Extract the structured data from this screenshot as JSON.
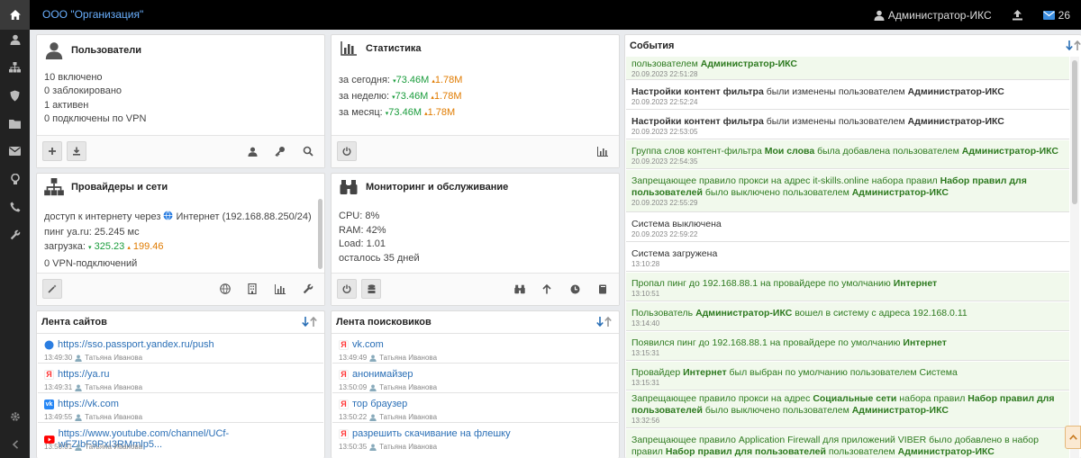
{
  "topbar": {
    "org_title": "ООО \"Организация\"",
    "user": "Администратор-ИКС",
    "messages_count": "26"
  },
  "sidebar": {
    "items": [
      "user-icon",
      "network-icon",
      "shield-icon",
      "folder-icon",
      "mail-icon",
      "bulb-icon",
      "phone-icon",
      "wrench-icon"
    ],
    "bottom": [
      "settings-icon",
      "collapse-icon"
    ]
  },
  "users": {
    "title": "Пользователи",
    "lines": [
      "10 включено",
      "0 заблокировано",
      "1 активен",
      "0 подключены по VPN"
    ]
  },
  "stats": {
    "title": "Статистика",
    "rows": [
      {
        "label": "за сегодня:",
        "down": "73.46M",
        "up": "1.78M"
      },
      {
        "label": "за неделю:",
        "down": "73.46M",
        "up": "1.78M"
      },
      {
        "label": "за месяц:",
        "down": "73.46M",
        "up": "1.78M"
      }
    ]
  },
  "providers": {
    "title": "Провайдеры и сети",
    "access_prefix": "доступ к интернету через",
    "access_value": "Интернет (192.168.88.250/24)",
    "ping": "пинг ya.ru: 25.245 мс",
    "load_label": "загрузка:",
    "load_down": "325.23",
    "load_up": "199.46",
    "vpn": "0 VPN-подключений"
  },
  "monitoring": {
    "title": "Мониторинг и обслуживание",
    "lines": [
      "CPU: 8%",
      "RAM: 42%",
      "Load: 1.01",
      "осталось 35 дней"
    ]
  },
  "sites": {
    "title": "Лента сайтов",
    "items": [
      {
        "url": "https://sso.passport.yandex.ru/push",
        "time": "13:49:30",
        "user": "Татьяна Иванова",
        "icon": "globe",
        "color": "#2a7de1"
      },
      {
        "url": "https://ya.ru",
        "time": "13:49:31",
        "user": "Татьяна Иванова",
        "icon": "ya",
        "color": "#ff3333"
      },
      {
        "url": "https://vk.com",
        "time": "13:49:55",
        "user": "Татьяна Иванова",
        "icon": "vk",
        "color": "#2787f5"
      },
      {
        "url": "https://www.youtube.com/channel/UCf-wFZIbF9PxI3RMmlp5...",
        "time": "13:50:01",
        "user": "Татьяна Иванова",
        "icon": "yt",
        "color": "#ff0000"
      }
    ]
  },
  "searches": {
    "title": "Лента поисковиков",
    "items": [
      {
        "query": "vk.com",
        "time": "13:49:49",
        "user": "Татьяна Иванова"
      },
      {
        "query": "анонимайзер",
        "time": "13:50:09",
        "user": "Татьяна Иванова"
      },
      {
        "query": "тор браузер",
        "time": "13:50:22",
        "user": "Татьяна Иванова"
      },
      {
        "query": "разрешить скачивание на флешку",
        "time": "13:50:35",
        "user": "Татьяна Иванова"
      }
    ]
  },
  "events": {
    "title": "События",
    "items": [
      {
        "style": "green",
        "parts": [
          [
            "пользователем ",
            false
          ],
          [
            "Администратор-ИКС",
            true
          ]
        ],
        "time": "20.09.2023 22:51:28"
      },
      {
        "style": "plain",
        "parts": [
          [
            "Настройки контент фильтра",
            true
          ],
          [
            " были изменены пользователем ",
            false
          ],
          [
            "Администратор-ИКС",
            true
          ]
        ],
        "time": "20.09.2023 22:52:24"
      },
      {
        "style": "plain",
        "parts": [
          [
            "Настройки контент фильтра",
            true
          ],
          [
            " были изменены пользователем ",
            false
          ],
          [
            "Администратор-ИКС",
            true
          ]
        ],
        "time": "20.09.2023 22:53:05"
      },
      {
        "style": "green",
        "parts": [
          [
            "Группа слов контент-фильтра ",
            false
          ],
          [
            "Мои слова",
            true
          ],
          [
            " была добавлена пользователем ",
            false
          ],
          [
            "Администратор-ИКС",
            true
          ]
        ],
        "time": "20.09.2023 22:54:35"
      },
      {
        "style": "green",
        "parts": [
          [
            "Запрещающее правило прокси на адрес it-skills.online набора правил ",
            false
          ],
          [
            "Набор правил для пользователей",
            true
          ],
          [
            " было выключено пользователем ",
            false
          ],
          [
            "Администратор-ИКС",
            true
          ]
        ],
        "time": "20.09.2023 22:55:29"
      },
      {
        "style": "plain",
        "parts": [
          [
            "Система выключена",
            false
          ]
        ],
        "time": "20.09.2023 22:59:22"
      },
      {
        "style": "plain",
        "parts": [
          [
            "Система загружена",
            false
          ]
        ],
        "time": "13:10:28"
      },
      {
        "style": "green",
        "parts": [
          [
            "Пропал пинг до 192.168.88.1 на провайдере по умолчанию ",
            false
          ],
          [
            "Интернет",
            true
          ]
        ],
        "time": "13:10:51"
      },
      {
        "style": "green",
        "parts": [
          [
            "Пользователь ",
            false
          ],
          [
            "Администратор-ИКС",
            true
          ],
          [
            " вошел в систему с адреса 192.168.0.11",
            false
          ]
        ],
        "time": "13:14:40"
      },
      {
        "style": "green",
        "parts": [
          [
            "Появился пинг до 192.168.88.1 на провайдере по умолчанию ",
            false
          ],
          [
            "Интернет",
            true
          ]
        ],
        "time": "13:15:31"
      },
      {
        "style": "green",
        "parts": [
          [
            "Провайдер ",
            false
          ],
          [
            "Интернет",
            true
          ],
          [
            " был выбран по умолчанию пользователем Система",
            false
          ]
        ],
        "time": "13:15:31"
      },
      {
        "style": "green",
        "parts": [
          [
            "Запрещающее правило прокси на адрес ",
            false
          ],
          [
            "Социальные сети",
            true
          ],
          [
            " набора правил ",
            false
          ],
          [
            "Набор правил для пользователей",
            true
          ],
          [
            " было выключено пользователем ",
            false
          ],
          [
            "Администратор-ИКС",
            true
          ]
        ],
        "time": "13:32:56"
      },
      {
        "style": "green",
        "parts": [
          [
            "Запрещающее правило Application Firewall для приложений VIBER было добавлено в набор правил ",
            false
          ],
          [
            "Набор правил для пользователей",
            true
          ],
          [
            " пользователем ",
            false
          ],
          [
            "Администратор-ИКС",
            true
          ]
        ],
        "time": ""
      }
    ]
  }
}
